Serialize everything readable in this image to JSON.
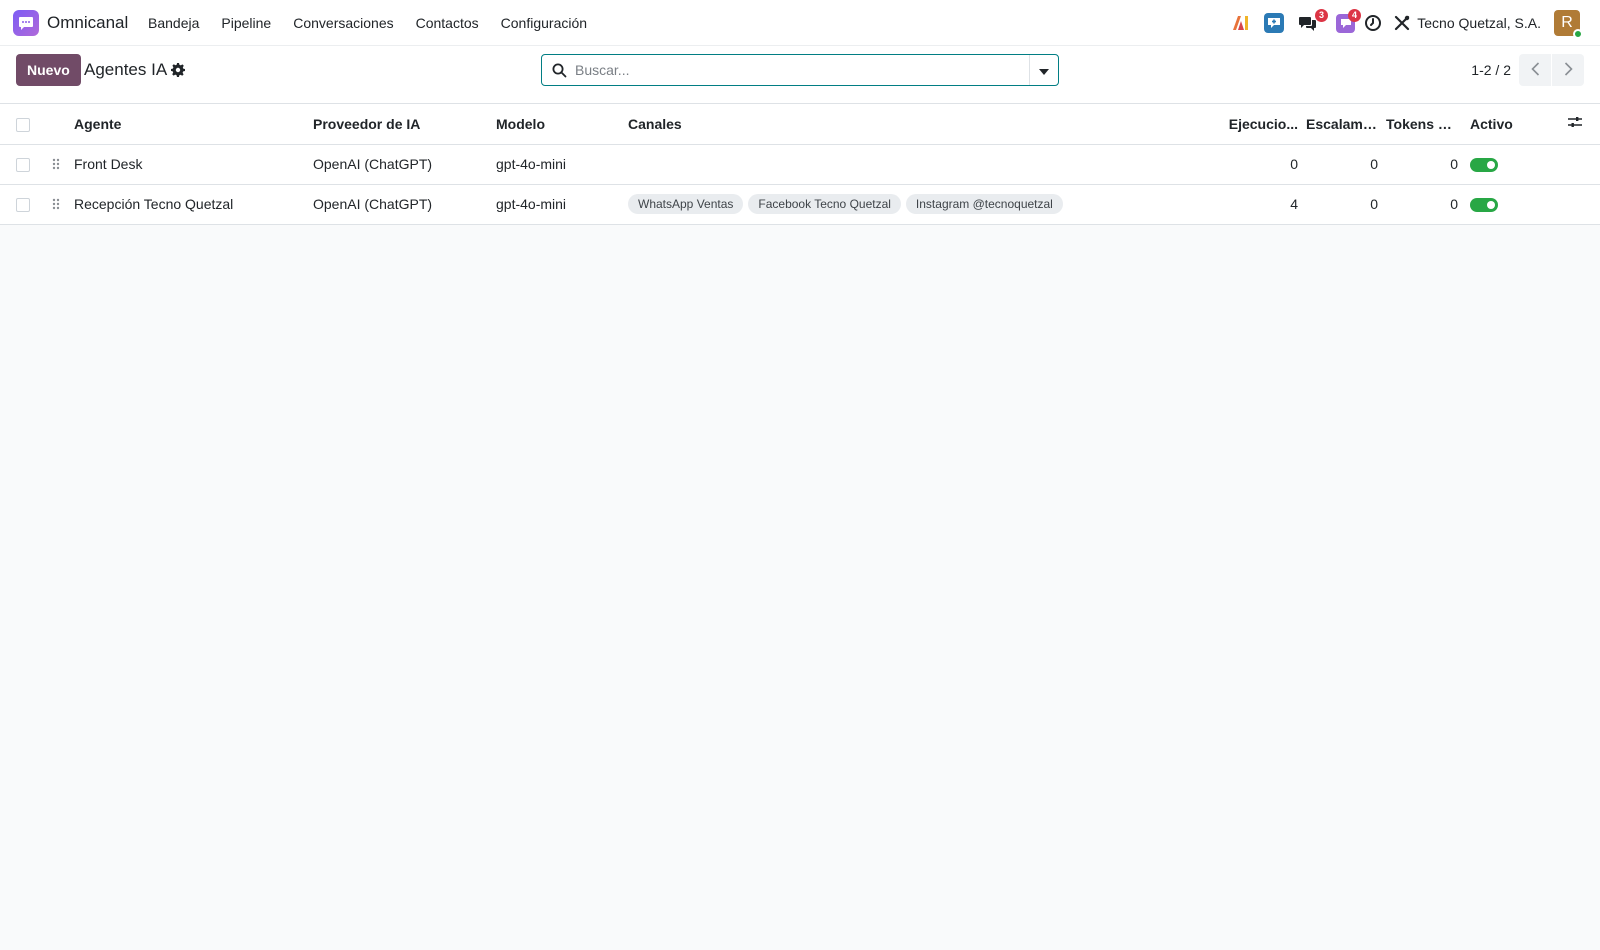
{
  "navbar": {
    "app_name": "Omnicanal",
    "menu": [
      "Bandeja",
      "Pipeline",
      "Conversaciones",
      "Contactos",
      "Configuración"
    ],
    "company": "Tecno Quetzal, S.A.",
    "avatar_initial": "R",
    "badges": {
      "messages": "3",
      "activities": "4"
    },
    "icons": [
      "ai-icon",
      "livechat-icon",
      "messages-icon",
      "activities-icon",
      "clock-icon",
      "tools-icon"
    ]
  },
  "control": {
    "new_button": "Nuevo",
    "title": "Agentes IA",
    "search_placeholder": "Buscar...",
    "pager": "1-2 / 2"
  },
  "table": {
    "columns": {
      "agent": "Agente",
      "provider": "Proveedor de IA",
      "model": "Modelo",
      "channels": "Canales",
      "executions": "Ejecucio...",
      "escalations": "Escalami...",
      "tokens": "Tokens u...",
      "active": "Activo"
    },
    "rows": [
      {
        "agent": "Front Desk",
        "provider": "OpenAI (ChatGPT)",
        "model": "gpt-4o-mini",
        "channels": [],
        "executions": "0",
        "escalations": "0",
        "tokens": "0",
        "active": true
      },
      {
        "agent": "Recepción Tecno Quetzal",
        "provider": "OpenAI (ChatGPT)",
        "model": "gpt-4o-mini",
        "channels": [
          "WhatsApp Ventas",
          "Facebook Tecno Quetzal",
          "Instagram @tecnoquetzal"
        ],
        "executions": "4",
        "escalations": "0",
        "tokens": "0",
        "active": true
      }
    ]
  },
  "colors": {
    "primary": "#714b67",
    "accent": "#017e84",
    "toggle_on": "#28a745",
    "badge": "#dc3545"
  }
}
